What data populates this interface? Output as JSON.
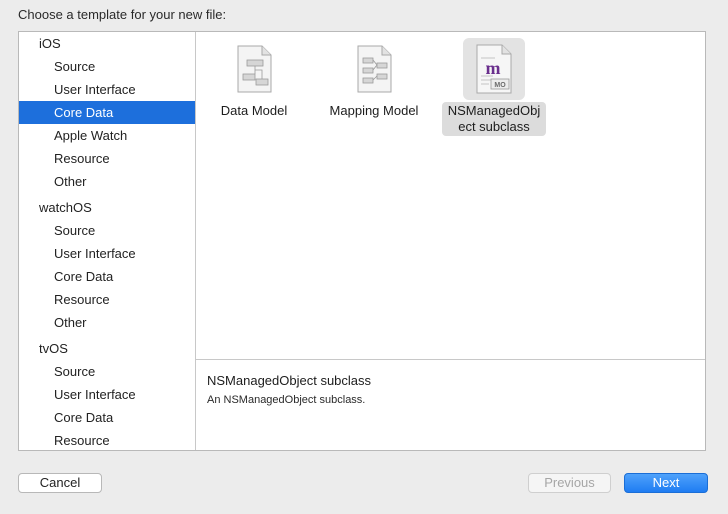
{
  "dialog": {
    "prompt": "Choose a template for your new file:"
  },
  "sidebar": {
    "groups": [
      {
        "name": "iOS",
        "items": [
          "Source",
          "User Interface",
          "Core Data",
          "Apple Watch",
          "Resource",
          "Other"
        ]
      },
      {
        "name": "watchOS",
        "items": [
          "Source",
          "User Interface",
          "Core Data",
          "Resource",
          "Other"
        ]
      },
      {
        "name": "tvOS",
        "items": [
          "Source",
          "User Interface",
          "Core Data",
          "Resource"
        ]
      }
    ],
    "selected": "iOS / Core Data"
  },
  "templates": [
    {
      "label": "Data Model",
      "icon": "data-model-document-icon",
      "selected": false
    },
    {
      "label": "Mapping Model",
      "icon": "mapping-model-document-icon",
      "selected": false
    },
    {
      "label_line1": "NSManagedObj",
      "label_line2": "ect subclass",
      "icon": "nsmanagedobject-document-icon",
      "selected": true
    }
  ],
  "details": {
    "title": "NSManagedObject subclass",
    "description": "An NSManagedObject subclass."
  },
  "buttons": {
    "cancel": "Cancel",
    "previous": "Previous",
    "next": "Next"
  },
  "icon_badge": {
    "letter": "m",
    "tag": "MO"
  },
  "colors": {
    "selection": "#1d6fdc",
    "next_button": "#2a86f5"
  }
}
